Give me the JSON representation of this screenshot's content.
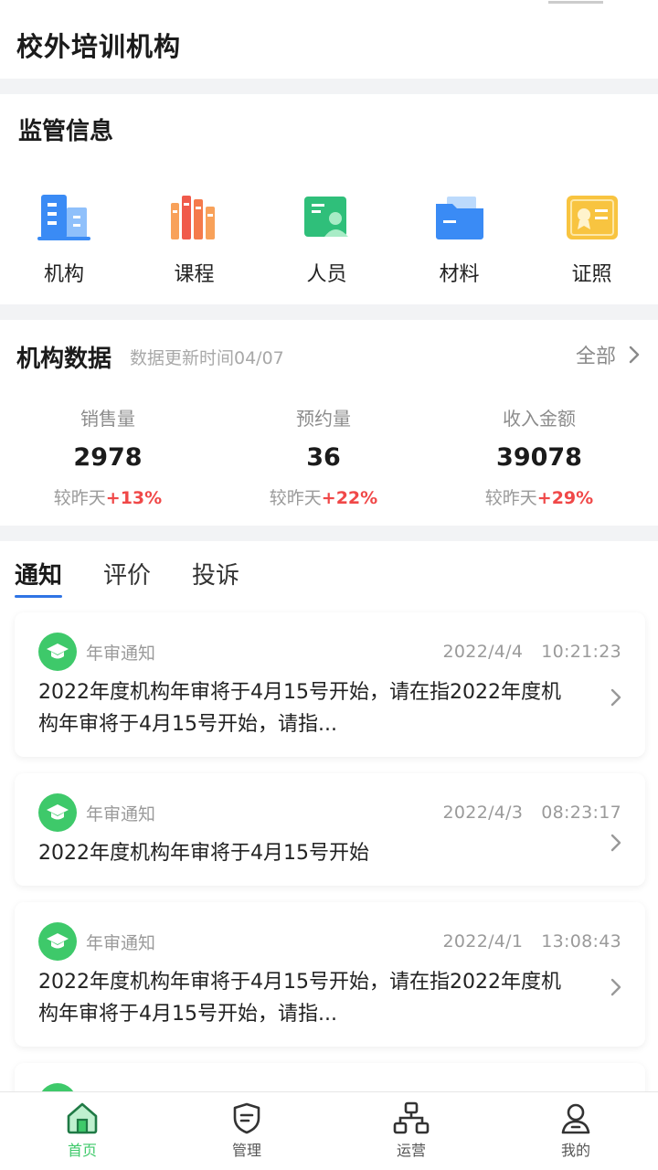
{
  "header": {
    "title": "校外培训机构"
  },
  "supervision": {
    "title": "监管信息",
    "items": [
      {
        "label": "机构",
        "icon": "building-icon",
        "color": "#3a8bf5"
      },
      {
        "label": "课程",
        "icon": "books-icon",
        "color": "#f57a4b"
      },
      {
        "label": "人员",
        "icon": "person-card-icon",
        "color": "#2fbf7a"
      },
      {
        "label": "材料",
        "icon": "folder-icon",
        "color": "#3a8bf5"
      },
      {
        "label": "证照",
        "icon": "certificate-icon",
        "color": "#f8c440"
      }
    ]
  },
  "org_data": {
    "title": "机构数据",
    "update_time": "数据更新时间04/07",
    "all_label": "全部",
    "stats": [
      {
        "label": "销售量",
        "value": "2978",
        "compare_prefix": "较昨天",
        "compare_value": "+13%"
      },
      {
        "label": "预约量",
        "value": "36",
        "compare_prefix": "较昨天",
        "compare_value": "+22%"
      },
      {
        "label": "收入金额",
        "value": "39078",
        "compare_prefix": "较昨天",
        "compare_value": "+29%"
      }
    ]
  },
  "tabs": [
    {
      "label": "通知",
      "active": true
    },
    {
      "label": "评价",
      "active": false
    },
    {
      "label": "投诉",
      "active": false
    }
  ],
  "notices": [
    {
      "type": "年审通知",
      "date": "2022/4/4",
      "time": "10:21:23",
      "text": "2022年度机构年审将于4月15号开始，请在指2022年度机构年审将于4月15号开始，请指..."
    },
    {
      "type": "年审通知",
      "date": "2022/4/3",
      "time": "08:23:17",
      "text": "2022年度机构年审将于4月15号开始"
    },
    {
      "type": "年审通知",
      "date": "2022/4/1",
      "time": "13:08:43",
      "text": "2022年度机构年审将于4月15号开始，请在指2022年度机构年审将于4月15号开始，请指..."
    }
  ],
  "tabbar": [
    {
      "label": "首页",
      "icon": "home-icon",
      "active": true
    },
    {
      "label": "管理",
      "icon": "shield-icon",
      "active": false
    },
    {
      "label": "运营",
      "icon": "org-chart-icon",
      "active": false
    },
    {
      "label": "我的",
      "icon": "user-icon",
      "active": false
    }
  ],
  "colors": {
    "accent_green": "#3ec96a",
    "up_red": "#f04848",
    "tab_underline": "#2f74e5"
  }
}
